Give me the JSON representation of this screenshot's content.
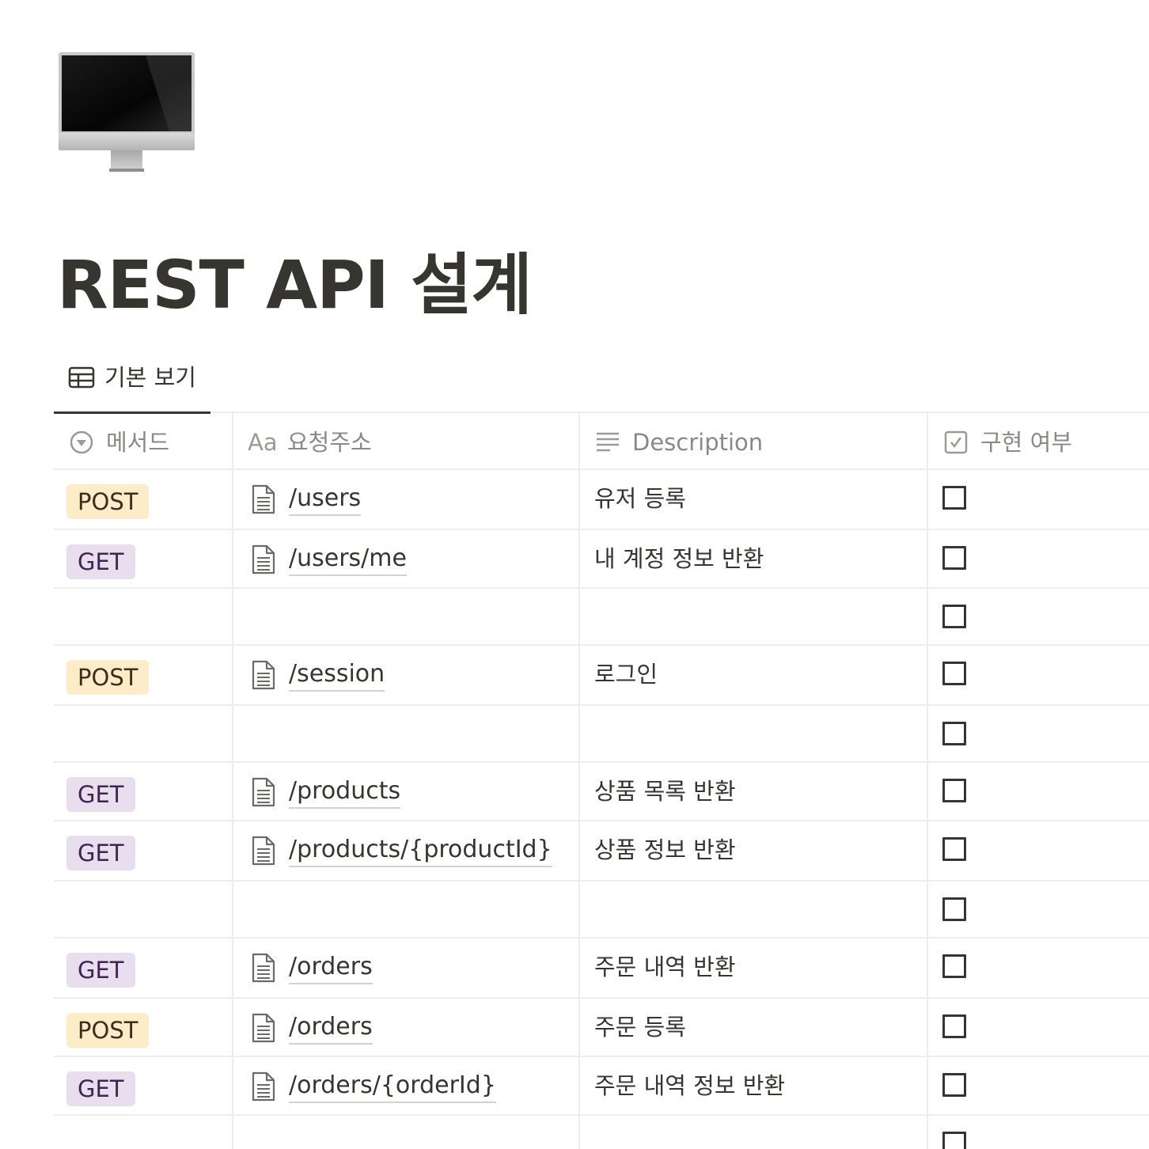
{
  "page": {
    "icon": "desktop-computer-icon",
    "title": "REST API 설계"
  },
  "view_tabs": [
    {
      "label": "기본 보기",
      "icon": "table-icon",
      "active": true
    }
  ],
  "table": {
    "columns": [
      {
        "label": "메서드",
        "icon": "select-property-icon"
      },
      {
        "label": "요청주소",
        "icon": "title-property-icon",
        "icon_text": "Aa"
      },
      {
        "label": "Description",
        "icon": "text-property-icon"
      },
      {
        "label": "구현 여부",
        "icon": "checkbox-property-icon"
      }
    ],
    "rows": [
      {
        "method": "POST",
        "endpoint": "/users",
        "description": "유저 등록",
        "implemented": false
      },
      {
        "method": "GET",
        "endpoint": "/users/me",
        "description": "내 계정 정보 반환",
        "implemented": false
      },
      {
        "method": "",
        "endpoint": "",
        "description": "",
        "implemented": false
      },
      {
        "method": "POST",
        "endpoint": "/session",
        "description": "로그인",
        "implemented": false
      },
      {
        "method": "",
        "endpoint": "",
        "description": "",
        "implemented": false
      },
      {
        "method": "GET",
        "endpoint": "/products",
        "description": "상품 목록 반환",
        "implemented": false
      },
      {
        "method": "GET",
        "endpoint": "/products/{productId}",
        "description": "상품 정보 반환",
        "implemented": false
      },
      {
        "method": "",
        "endpoint": "",
        "description": "",
        "implemented": false
      },
      {
        "method": "GET",
        "endpoint": "/orders",
        "description": "주문 내역 반환",
        "implemented": false
      },
      {
        "method": "POST",
        "endpoint": "/orders",
        "description": "주문 등록",
        "implemented": false
      },
      {
        "method": "GET",
        "endpoint": "/orders/{orderId}",
        "description": "주문 내역 정보 반환",
        "implemented": false
      },
      {
        "method": "",
        "endpoint": "",
        "description": "",
        "implemented": false
      }
    ]
  },
  "colors": {
    "post_tag_bg": "#fdecc8",
    "get_tag_bg": "#e8deee",
    "text": "#37352f",
    "header_text": "#8a8985",
    "border": "#ededeb"
  }
}
